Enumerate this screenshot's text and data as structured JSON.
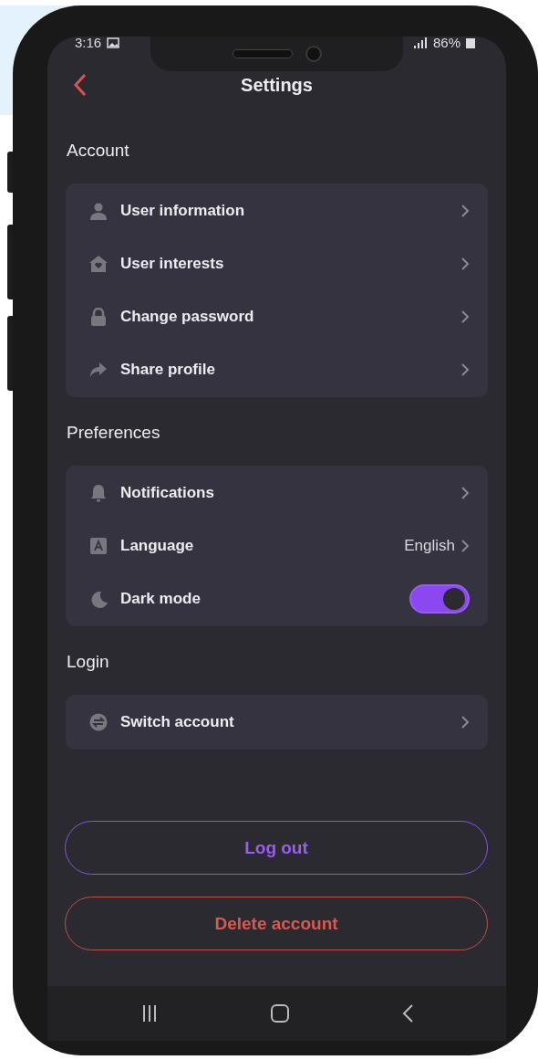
{
  "status_bar": {
    "time": "3:16",
    "battery": "86%"
  },
  "header": {
    "title": "Settings"
  },
  "sections": [
    {
      "title": "Account",
      "items": [
        {
          "kind": "link",
          "label": "User information"
        },
        {
          "kind": "link",
          "label": "User interests"
        },
        {
          "kind": "link",
          "label": "Change password"
        },
        {
          "kind": "link",
          "label": "Share profile"
        }
      ]
    },
    {
      "title": "Preferences",
      "items": [
        {
          "kind": "link",
          "label": "Notifications"
        },
        {
          "kind": "value",
          "label": "Language",
          "value": "English"
        },
        {
          "kind": "toggle",
          "label": "Dark mode",
          "on": true
        }
      ]
    },
    {
      "title": "Login",
      "items": [
        {
          "kind": "link",
          "label": "Switch account"
        }
      ]
    }
  ],
  "actions": [
    {
      "kind": "primary",
      "label": "Log out"
    },
    {
      "kind": "danger",
      "label": "Delete account"
    }
  ]
}
